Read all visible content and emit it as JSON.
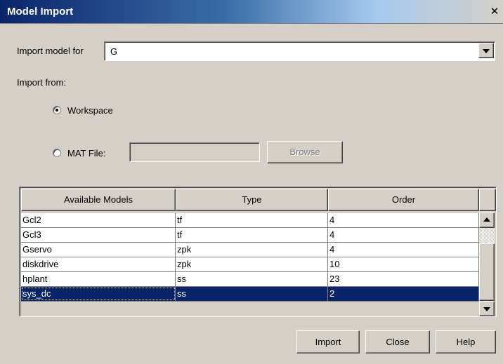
{
  "window": {
    "title": "Model Import"
  },
  "import_for": {
    "label": "Import model for",
    "value": "G"
  },
  "import_from": {
    "label": "Import from:"
  },
  "source": {
    "workspace_label": "Workspace",
    "mat_file_label": "MAT File:",
    "mat_file_value": "",
    "browse_label": "Browse",
    "selected": "Workspace"
  },
  "models_table": {
    "columns": [
      "Available Models",
      "Type",
      "Order"
    ],
    "rows": [
      [
        "Gcl2",
        "tf",
        "4"
      ],
      [
        "Gcl3",
        "tf",
        "4"
      ],
      [
        "Gservo",
        "zpk",
        "4"
      ],
      [
        "diskdrive",
        "zpk",
        "10"
      ],
      [
        "hplant",
        "ss",
        "23"
      ],
      [
        "sys_dc",
        "ss",
        "2"
      ]
    ],
    "selected_row": "sys_dc"
  },
  "buttons": {
    "import": "Import",
    "close": "Close",
    "help": "Help"
  },
  "colors": {
    "selection": "#0a246a",
    "background": "#d4d0c8",
    "title_bar": "#0a246a"
  }
}
